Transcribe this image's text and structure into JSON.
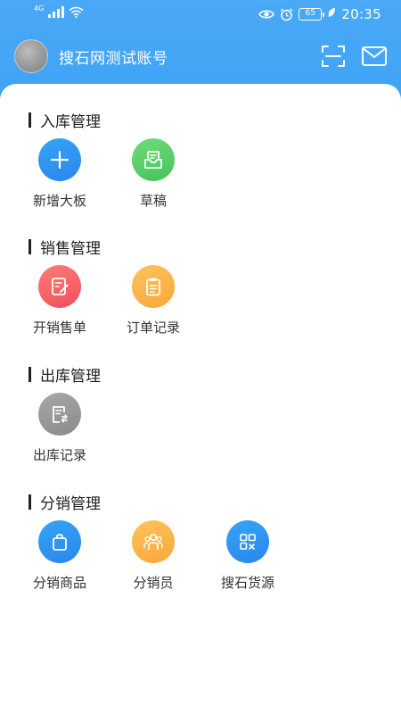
{
  "status_bar": {
    "network_label": "4G",
    "battery": "65",
    "time": "20:35"
  },
  "account": {
    "name": "搜石网测试账号"
  },
  "sections": [
    {
      "title": "入库管理",
      "items": [
        {
          "label": "新增大板",
          "icon": "plus-icon",
          "color": "#2f95f0"
        },
        {
          "label": "草稿",
          "icon": "draft-icon",
          "color": "#55c965"
        }
      ]
    },
    {
      "title": "销售管理",
      "items": [
        {
          "label": "开销售单",
          "icon": "create-order-icon",
          "color": "#f4606a"
        },
        {
          "label": "订单记录",
          "icon": "clipboard-icon",
          "color": "#fbb34a"
        }
      ]
    },
    {
      "title": "出库管理",
      "items": [
        {
          "label": "出库记录",
          "icon": "outbound-record-icon",
          "color": "#999999"
        }
      ]
    },
    {
      "title": "分销管理",
      "items": [
        {
          "label": "分销商品",
          "icon": "shopping-bag-icon",
          "color": "#2f95f0"
        },
        {
          "label": "分销员",
          "icon": "people-icon",
          "color": "#fbb34a"
        },
        {
          "label": "搜石货源",
          "icon": "grid-search-icon",
          "color": "#2f95f0"
        }
      ]
    }
  ]
}
